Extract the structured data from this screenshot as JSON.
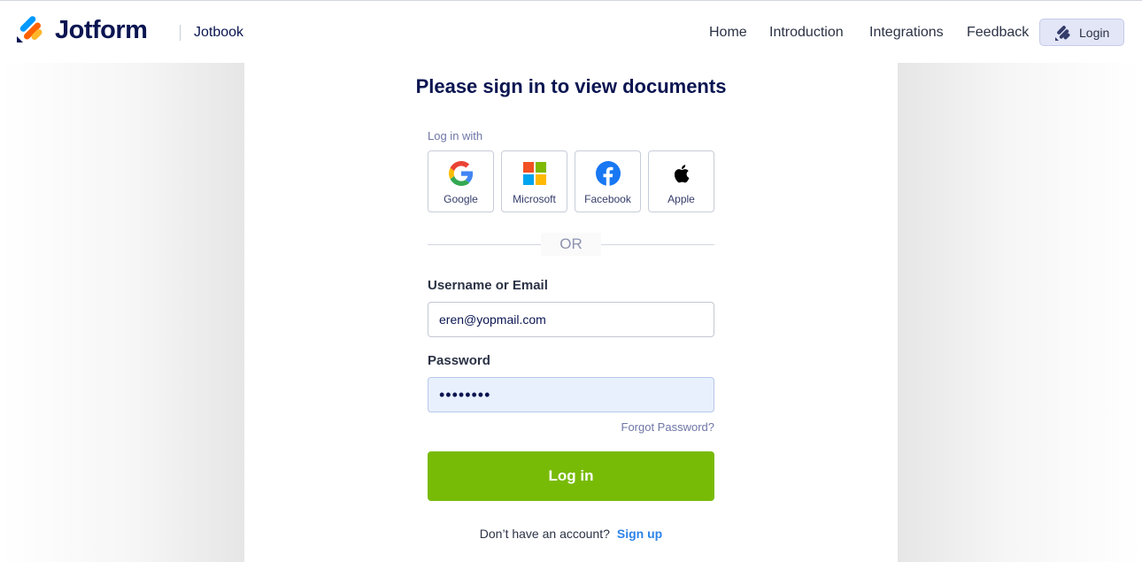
{
  "header": {
    "brand": "Jotform",
    "product": "Jotbook",
    "nav": [
      "Home",
      "Introduction",
      "Integrations",
      "Feedback"
    ],
    "login_label": "Login"
  },
  "main": {
    "title": "Please sign in to view documents",
    "login_with": "Log in with",
    "social": [
      {
        "label": "Google",
        "icon": "google-icon"
      },
      {
        "label": "Microsoft",
        "icon": "microsoft-icon"
      },
      {
        "label": "Facebook",
        "icon": "facebook-icon"
      },
      {
        "label": "Apple",
        "icon": "apple-icon"
      }
    ],
    "or_text": "OR",
    "username_label": "Username or Email",
    "username_value": "eren@yopmail.com",
    "password_label": "Password",
    "password_value": "••••••••",
    "forgot_label": "Forgot Password?",
    "submit_label": "Log in",
    "no_account_text": "Don’t have an account?",
    "signup_label": "Sign up"
  },
  "colors": {
    "brand_navy": "#0a1551",
    "login_green": "#78bb07",
    "link_blue": "#2d83e8",
    "login_button_bg": "#e3e6f6"
  }
}
